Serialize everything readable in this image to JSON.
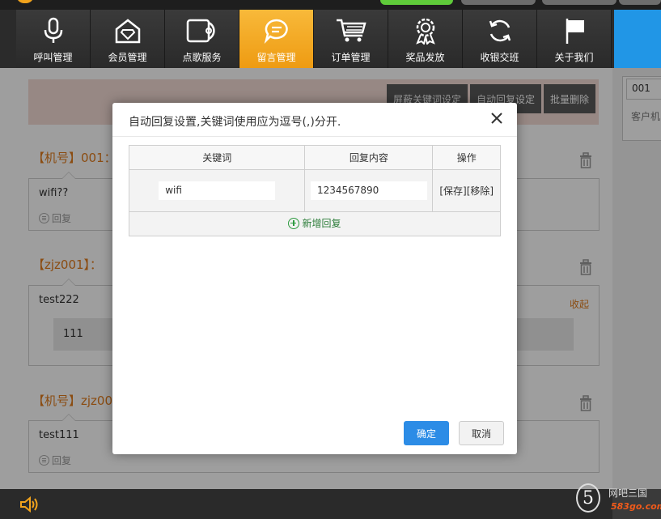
{
  "colors": {
    "accent_orange": "#f2a31c",
    "nav_dark": "#2b2b2b",
    "primary_blue": "#2c8ce6",
    "brand_orange": "#e07b1c",
    "success_green": "#2d9a3f"
  },
  "nav": {
    "items": [
      {
        "label": "呼叫管理",
        "icon": "microphone-icon"
      },
      {
        "label": "会员管理",
        "icon": "diamond-house-icon"
      },
      {
        "label": "点歌服务",
        "icon": "cd-icon"
      },
      {
        "label": "留言管理",
        "icon": "message-bubble-icon",
        "active": true
      },
      {
        "label": "订单管理",
        "icon": "shopping-cart-icon"
      },
      {
        "label": "奖品发放",
        "icon": "award-icon"
      },
      {
        "label": "收银交班",
        "icon": "refresh-icon"
      },
      {
        "label": "关于我们",
        "icon": "flag-icon"
      }
    ]
  },
  "toolbar": {
    "block_keywords": "屏蔽关键词设定",
    "auto_reply": "自动回复设定",
    "bulk_delete": "批量删除"
  },
  "messages": [
    {
      "head": "【机号】001：",
      "text": "wifi??",
      "reply": "回复"
    },
    {
      "head": "【zjz001】：",
      "text": "test222",
      "sub_reply": "111",
      "collapse": "收起"
    },
    {
      "head": "【机号】zjz00",
      "text": "test111",
      "reply": "回复"
    }
  ],
  "right_panel": {
    "input_value": "001",
    "label": "客户机"
  },
  "brand": {
    "logo": "5",
    "name": "网吧三国",
    "site": "583go.com"
  },
  "modal": {
    "title": "自动回复设置,关键词使用应为逗号(,)分开.",
    "columns": [
      "关键词",
      "回复内容",
      "操作"
    ],
    "rows": [
      {
        "keyword": "wifi",
        "reply": "1234567890",
        "ops": "[保存][移除]"
      }
    ],
    "add_label": "新增回复",
    "ok_label": "确定",
    "cancel_label": "取消"
  }
}
